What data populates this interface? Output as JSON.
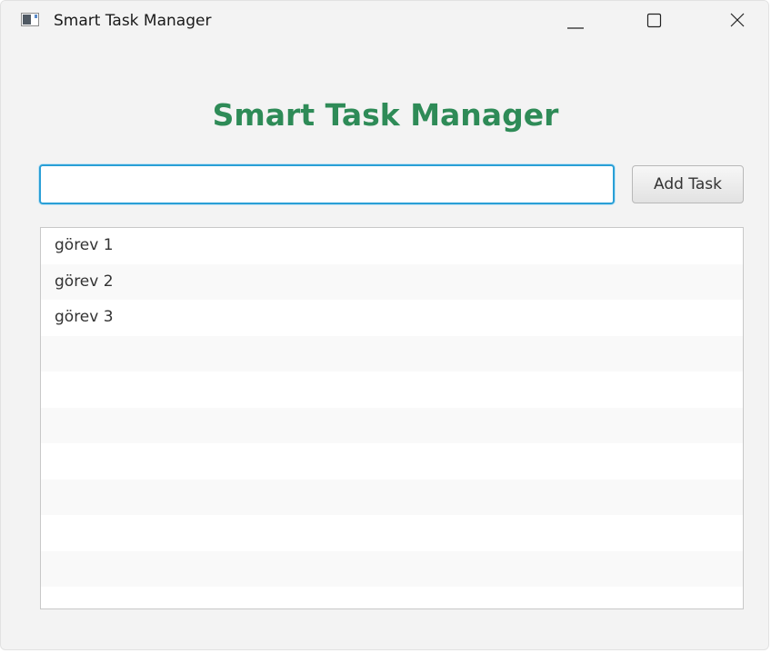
{
  "window": {
    "title": "Smart Task Manager",
    "icon": "app-window-icon",
    "controls": [
      "minimize-icon",
      "maximize-icon",
      "close-icon"
    ]
  },
  "main": {
    "heading": "Smart Task Manager",
    "heading_color": "#2e8b57",
    "input": {
      "value": "",
      "placeholder": "",
      "focus_color": "#2a9fd6"
    },
    "add_button_label": "Add Task"
  },
  "tasks": [
    {
      "label": "görev 1"
    },
    {
      "label": "görev 2"
    },
    {
      "label": "görev 3"
    }
  ],
  "list": {
    "row_color": "#ffffff",
    "alt_row_color": "#f9f9f9"
  }
}
